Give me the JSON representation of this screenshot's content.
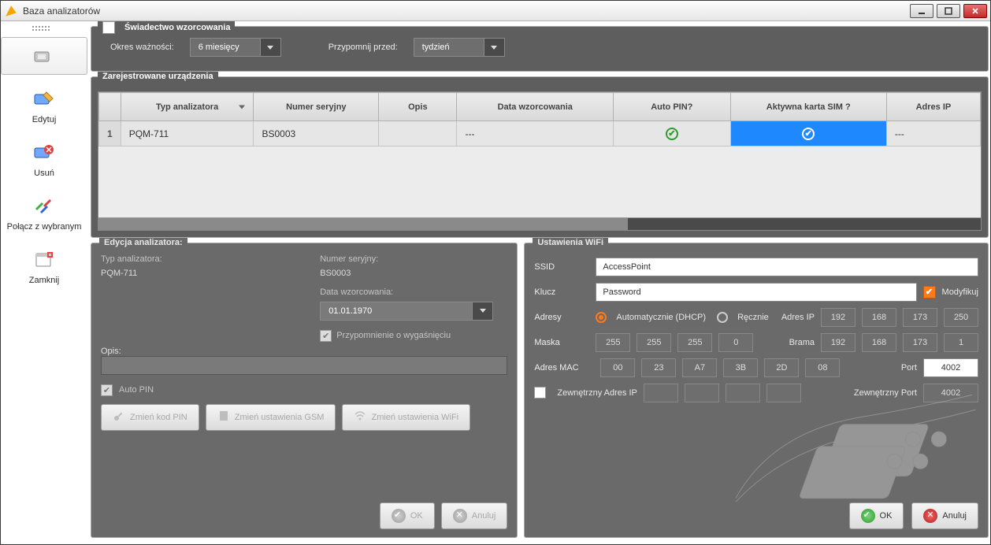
{
  "window": {
    "title": "Baza analizatorów"
  },
  "sidebar": {
    "items": [
      {
        "label": ""
      },
      {
        "label": "Edytuj"
      },
      {
        "label": "Usuń"
      },
      {
        "label": "Połącz z wybranym"
      },
      {
        "label": "Zamknij"
      }
    ]
  },
  "cert": {
    "legend": "Świadectwo wzorcowania",
    "validity_label": "Okres ważności:",
    "validity_value": "6 miesięcy",
    "remind_label": "Przypomnij przed:",
    "remind_value": "tydzień"
  },
  "devices": {
    "legend": "Zarejestrowane urządzenia",
    "headers": {
      "type": "Typ analizatora",
      "serial": "Numer seryjny",
      "desc": "Opis",
      "caldate": "Data wzorcowania",
      "autopin": "Auto PIN?",
      "sim": "Aktywna karta SIM ?",
      "ip": "Adres IP"
    },
    "rows": [
      {
        "n": "1",
        "type": "PQM-711",
        "serial": "BS0003",
        "desc": "",
        "caldate": "---",
        "autopin": true,
        "sim": true,
        "ip": "---"
      }
    ]
  },
  "edit": {
    "legend": "Edycja analizatora:",
    "type_label": "Typ analizatora:",
    "type_value": "PQM-711",
    "serial_label": "Numer seryjny:",
    "serial_value": "BS0003",
    "caldate_label": "Data wzorcowania:",
    "caldate_value": "01.01.1970",
    "expiry_reminder": "Przypomnienie o wygaśnięciu",
    "desc_label": "Opis:",
    "desc_value": "",
    "autopin_label": "Auto PIN",
    "btn_pin": "Zmień kod PIN",
    "btn_gsm": "Zmień ustawienia GSM",
    "btn_wifi": "Zmień ustawienia WiFi",
    "ok": "OK",
    "cancel": "Anuluj"
  },
  "wifi": {
    "legend": "Ustawienia WiFi",
    "ssid_label": "SSID",
    "ssid_value": "AccessPoint",
    "key_label": "Klucz",
    "key_value": "Password",
    "modify_label": "Modyfikuj",
    "addr_label": "Adresy",
    "dhcp_label": "Automatycznie (DHCP)",
    "manual_label": "Ręcznie",
    "ip_label": "Adres IP",
    "ip": [
      "192",
      "168",
      "173",
      "250"
    ],
    "mask_label": "Maska",
    "mask": [
      "255",
      "255",
      "255",
      "0"
    ],
    "gw_label": "Brama",
    "gw": [
      "192",
      "168",
      "173",
      "1"
    ],
    "mac_label": "Adres MAC",
    "mac": [
      "00",
      "23",
      "A7",
      "3B",
      "2D",
      "08"
    ],
    "port_label": "Port",
    "port_value": "4002",
    "ext_ip_label": "Zewnętrzny Adres IP",
    "ext_ip": [
      "",
      "",
      "",
      ""
    ],
    "ext_port_label": "Zewnętrzny Port",
    "ext_port_value": "4002",
    "ok": "OK",
    "cancel": "Anuluj"
  }
}
